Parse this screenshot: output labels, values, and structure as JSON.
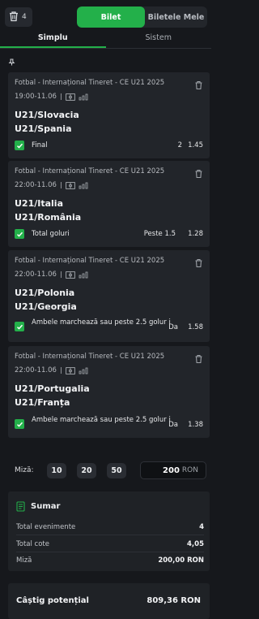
{
  "header": {
    "bet_count": "4",
    "segment_active": "Bilet",
    "segment_inactive": "Biletele Mele"
  },
  "tabs": [
    {
      "label": "Simplu",
      "active": true
    },
    {
      "label": "Sistem",
      "active": false
    }
  ],
  "selections": [
    {
      "league": "Fotbal - Internațional Tineret - CE U21 2025",
      "time": "19:00-11.06",
      "home": "U21/Slovacia",
      "away": "U21/Spania",
      "market": "Final",
      "pick": "2",
      "odd": "1.45"
    },
    {
      "league": "Fotbal - Internațional Tineret - CE U21 2025",
      "time": "22:00-11.06",
      "home": "U21/Italia",
      "away": "U21/România",
      "market": "Total goluri",
      "pick": "Peste 1.5",
      "odd": "1.28"
    },
    {
      "league": "Fotbal - Internațional Tineret - CE U21 2025",
      "time": "22:00-11.06",
      "home": "U21/Polonia",
      "away": "U21/Georgia",
      "market": "Ambele marchează sau peste 2.5 golur i",
      "pick": "Da",
      "odd": "1.58"
    },
    {
      "league": "Fotbal - Internațional Tineret - CE U21 2025",
      "time": "22:00-11.06",
      "home": "U21/Portugalia",
      "away": "U21/Franța",
      "market": "Ambele marchează sau peste 2.5 golur i",
      "pick": "Da",
      "odd": "1.38"
    }
  ],
  "stake": {
    "label": "Miză:",
    "quick": [
      "10",
      "20",
      "50"
    ],
    "value": "200",
    "currency": "RON"
  },
  "summary": {
    "title": "Sumar",
    "rows": [
      {
        "label": "Total evenimente",
        "value": "4"
      },
      {
        "label": "Total cote",
        "value": "4,05"
      },
      {
        "label": "Miză",
        "value": "200,00 RON"
      }
    ]
  },
  "potential": {
    "label": "Câștig potențial",
    "value": "809,36 RON"
  },
  "colors": {
    "accent": "#23b04a",
    "background": "#16181c",
    "card": "#22252a"
  }
}
